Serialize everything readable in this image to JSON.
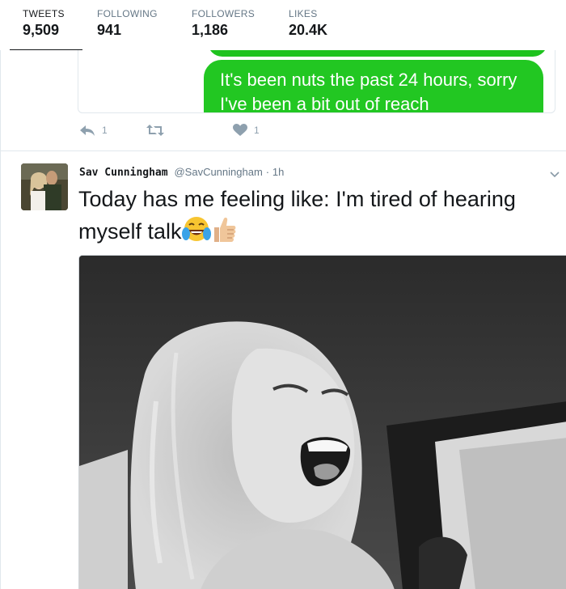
{
  "profile_nav": {
    "tweets": {
      "label": "TWEETS",
      "value": "9,509"
    },
    "following": {
      "label": "FOLLOWING",
      "value": "941"
    },
    "followers": {
      "label": "FOLLOWERS",
      "value": "1,186"
    },
    "likes": {
      "label": "LIKES",
      "value": "20.4K"
    },
    "active_tab": "tweets"
  },
  "previous_tweet": {
    "message_text": "It's been nuts the past 24 hours, sorry I've been a bit out of reach",
    "bubble_color": "#22c722",
    "reply_count": "1",
    "like_count": "1"
  },
  "tweet": {
    "author_name": "Sav Cunningham",
    "author_handle": "@SavCunningham",
    "separator": "·",
    "time": "1h",
    "text": "Today has me feeling like:  I'm tired of hearing myself talk",
    "emojis": [
      "face-with-tears-of-joy",
      "thumbs-up"
    ]
  },
  "colors": {
    "text": "#14171a",
    "muted": "#657786",
    "action_icon": "#8ea0ae",
    "border": "#e1e8ed"
  }
}
